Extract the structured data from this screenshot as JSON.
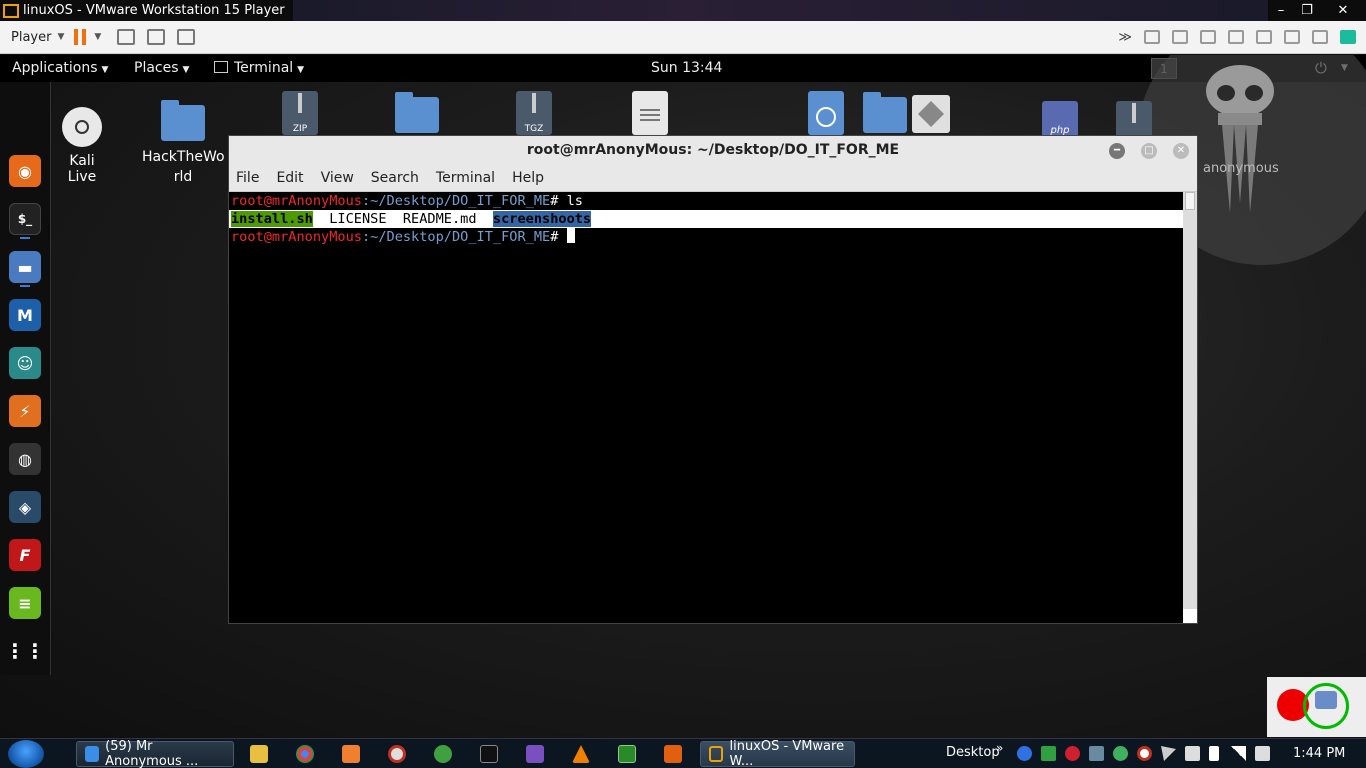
{
  "host": {
    "title": "linuxOS - VMware Workstation 15 Player",
    "min": "–",
    "max": "❐",
    "close": "✕"
  },
  "vmware_toolbar": {
    "player_label": "Player"
  },
  "gnome": {
    "applications": "Applications",
    "places": "Places",
    "terminal": "Terminal",
    "clock": "Sun 13:44",
    "workspace": "1"
  },
  "desktop": {
    "kali_live": "Kali Live",
    "hacktheworld": "HackTheWo rld",
    "zip_label": "ZIP",
    "tgz_label": "TGZ",
    "php_label": "php",
    "anonymous_label": "anonymous"
  },
  "terminal": {
    "title": "root@mrAnonyMous: ~/Desktop/DO_IT_FOR_ME",
    "menu": [
      "File",
      "Edit",
      "View",
      "Search",
      "Terminal",
      "Help"
    ],
    "prompt_user": "root@mrAnonyMous",
    "prompt_path": ":~/Desktop/DO_IT_FOR_ME",
    "prompt_hash": "#",
    "cmd1": " ls",
    "ls_exe": "install.sh",
    "ls_plain": "  LICENSE  README.md  ",
    "ls_dir": "screenshoots"
  },
  "taskbar": {
    "task1": "(59) Mr Anonymous ...",
    "task2": "linuxOS - VMware W...",
    "desktop_label": "Desktop",
    "chevron": "»",
    "time": "1:44 PM"
  }
}
